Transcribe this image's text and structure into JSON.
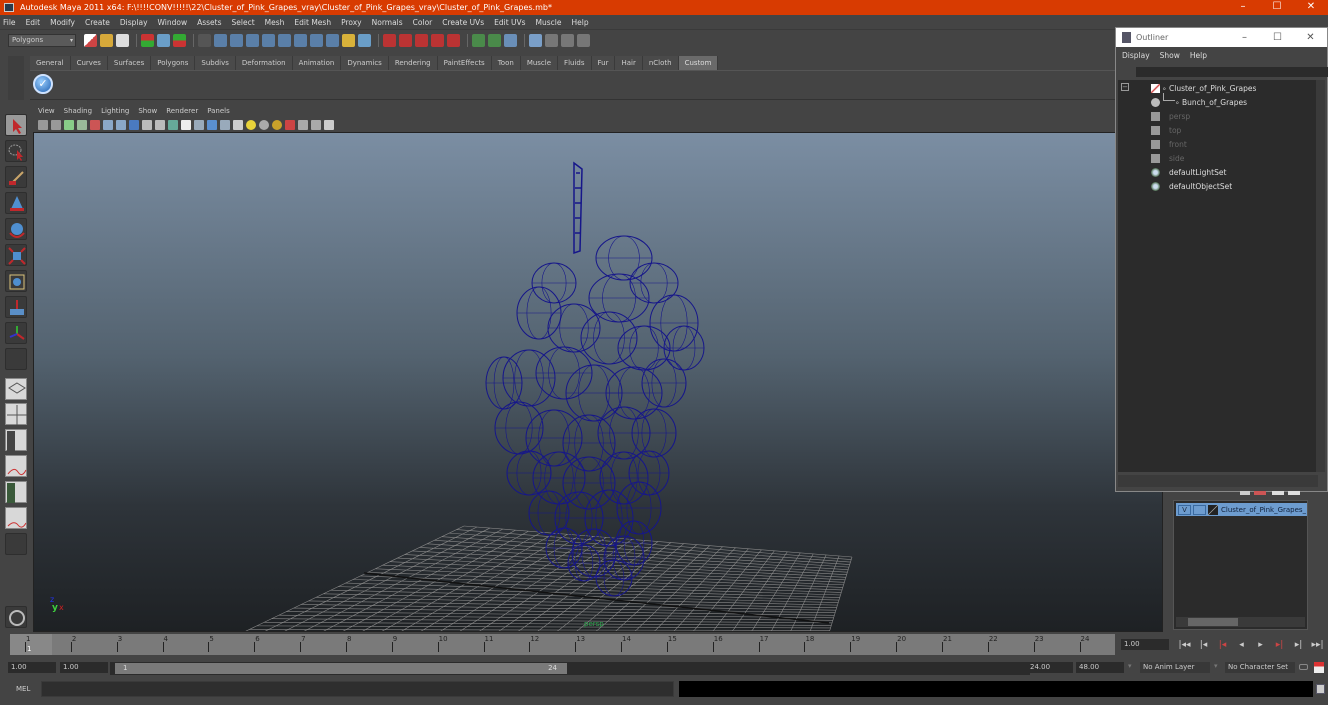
{
  "window": {
    "title": "Autodesk Maya 2011 x64: F:\\!!!!CONV!!!!!\\22\\Cluster_of_Pink_Grapes_vray\\Cluster_of_Pink_Grapes_vray\\Cluster_of_Pink_Grapes.mb*",
    "minimize": "–",
    "maximize": "☐",
    "close": "✕"
  },
  "menubar": [
    "File",
    "Edit",
    "Modify",
    "Create",
    "Display",
    "Window",
    "Assets",
    "Select",
    "Mesh",
    "Edit Mesh",
    "Proxy",
    "Normals",
    "Color",
    "Create UVs",
    "Edit UVs",
    "Muscle",
    "Help"
  ],
  "statusline": {
    "mode": "Polygons",
    "mode_arrow": "▾"
  },
  "shelf": {
    "tabs": [
      "General",
      "Curves",
      "Surfaces",
      "Polygons",
      "Subdivs",
      "Deformation",
      "Animation",
      "Dynamics",
      "Rendering",
      "PaintEffects",
      "Toon",
      "Muscle",
      "Fluids",
      "Fur",
      "Hair",
      "nCloth",
      "Custom"
    ],
    "active_tab": "Custom",
    "check_icon": "✓"
  },
  "panel": {
    "menu": [
      "View",
      "Shading",
      "Lighting",
      "Show",
      "Renderer",
      "Panels"
    ],
    "camera_label": "persp",
    "axis": {
      "x": "x",
      "y": "y",
      "z": "z"
    }
  },
  "outliner": {
    "title": "Outliner",
    "menu": [
      "Display",
      "Show",
      "Help"
    ],
    "expand_icon": "−",
    "items": [
      {
        "label": "Cluster_of_Pink_Grapes",
        "icon": "transform-icon",
        "dim": false
      },
      {
        "label": "Bunch_of_Grapes",
        "icon": "mesh-icon",
        "dim": false
      },
      {
        "label": "persp",
        "icon": "camera-icon",
        "dim": true
      },
      {
        "label": "top",
        "icon": "camera-icon",
        "dim": true
      },
      {
        "label": "front",
        "icon": "camera-icon",
        "dim": true
      },
      {
        "label": "side",
        "icon": "camera-icon",
        "dim": true
      },
      {
        "label": "defaultLightSet",
        "icon": "set-icon",
        "dim": false
      },
      {
        "label": "defaultObjectSet",
        "icon": "set-icon",
        "dim": false
      }
    ]
  },
  "layers": {
    "rows": [
      {
        "visible": "V",
        "name": "Cluster_of_Pink_Grapes_"
      }
    ]
  },
  "timeslider": {
    "ticks": [
      "1",
      "2",
      "3",
      "4",
      "5",
      "6",
      "7",
      "8",
      "9",
      "10",
      "11",
      "12",
      "13",
      "14",
      "15",
      "16",
      "17",
      "18",
      "19",
      "20",
      "21",
      "22",
      "23",
      "24"
    ],
    "current_frame": "1",
    "current_time": "1.00",
    "playback": [
      "|◂◂",
      "|◂",
      "|◂",
      "◂",
      "▸",
      "▸|",
      "▸|",
      "▸▸|"
    ]
  },
  "range": {
    "start_time": "1.00",
    "playback_start": "1.00",
    "range_start": "1",
    "range_end": "24",
    "playback_end": "24.00",
    "end_time": "48.00",
    "anim_layer": "No Anim Layer",
    "character_set": "No Character Set"
  },
  "commandline": {
    "label": "MEL"
  }
}
